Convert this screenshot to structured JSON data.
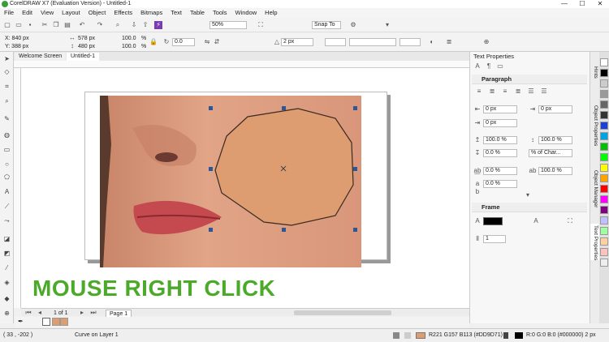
{
  "window": {
    "title": "CorelDRAW X7 (Evaluation Version) - Untitled-1",
    "min": "—",
    "max": "☐",
    "close": "✕"
  },
  "menu": [
    "File",
    "Edit",
    "View",
    "Layout",
    "Object",
    "Effects",
    "Bitmaps",
    "Text",
    "Table",
    "Tools",
    "Window",
    "Help"
  ],
  "toolbar": {
    "zoom": "50%",
    "snap": "Snap To"
  },
  "properties": {
    "x": "X: 840 px",
    "y": "Y: 388 px",
    "w": "578 px",
    "h": "480 px",
    "sx": "100.0",
    "sy": "100.0",
    "pct": "%",
    "angle": "0.0",
    "outline": "2 px"
  },
  "doc_tabs": {
    "welcome": "Welcome Screen",
    "doc": "Untitled-1"
  },
  "caption": "MOUSE RIGHT CLICK",
  "page_nav": {
    "count": "1 of 1",
    "page": "Page 1"
  },
  "docker": {
    "title": "Text Properties",
    "paragraph": "Paragraph",
    "v_0px_a": "0 px",
    "v_0px_b": "0 px",
    "v_0px_c": "0 px",
    "v_100a": "100.0 %",
    "v_100b": "100.0 %",
    "v_0a": "0.0 %",
    "spacing_unit": "% of Char...",
    "v_0b": "0.0 %",
    "v_0c": "0.0 %",
    "v_100c": "100.0 %",
    "frame": "Frame",
    "columns": "1"
  },
  "vtabs": [
    "Hints",
    "Object Properties",
    "Object Manager",
    "Text Properties"
  ],
  "status": {
    "coords": "( 33 , -202 )",
    "object": "Curve on Layer 1",
    "fill": "R221 G157 B113 (#DD9D71)",
    "outline": "R:0 G:0 B:0 (#000000)  2 px"
  },
  "colors": {
    "fill": "#DD9D71",
    "caption": "#4caa2a",
    "outline": "#000000"
  },
  "palette": [
    "#ffffff",
    "#000000",
    "#cccccc",
    "#999999",
    "#666666",
    "#333333",
    "#1c3fd6",
    "#00a4e0",
    "#00c000",
    "#00ff00",
    "#ffff00",
    "#ffa500",
    "#ff0000",
    "#ff00ff",
    "#800080",
    "#c0c0ff",
    "#a0ffa0",
    "#ffd0a0",
    "#ffc0c0",
    "#eeeeee"
  ]
}
